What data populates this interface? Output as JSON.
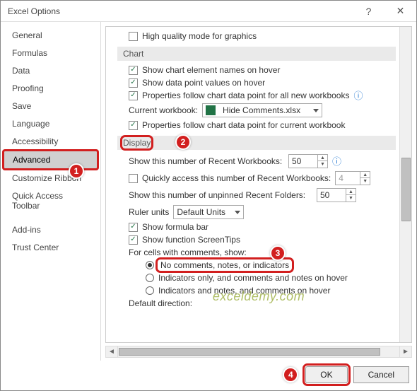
{
  "titlebar": {
    "title": "Excel Options",
    "help_icon": "?",
    "close_icon": "✕"
  },
  "sidebar": {
    "items": [
      {
        "label": "General"
      },
      {
        "label": "Formulas"
      },
      {
        "label": "Data"
      },
      {
        "label": "Proofing"
      },
      {
        "label": "Save"
      },
      {
        "label": "Language"
      },
      {
        "label": "Accessibility"
      },
      {
        "label": "Advanced"
      },
      {
        "label": "Customize Ribbon"
      },
      {
        "label": "Quick Access Toolbar"
      },
      {
        "label": "Add-ins"
      },
      {
        "label": "Trust Center"
      }
    ],
    "selected_index": 7
  },
  "main": {
    "top_checkbox": {
      "checked": false,
      "label": "High quality mode for graphics"
    },
    "chart_header": "Chart",
    "chart": {
      "show_element_names": {
        "checked": true,
        "label": "Show chart element names on hover"
      },
      "show_values": {
        "checked": true,
        "label": "Show data point values on hover"
      },
      "properties_all": {
        "checked": true,
        "label": "Properties follow chart data point for all new workbooks"
      },
      "current_workbook_label": "Current workbook:",
      "current_workbook_value": "Hide Comments.xlsx",
      "properties_current": {
        "checked": true,
        "label": "Properties follow chart data point for current workbook"
      }
    },
    "display_header": "Display",
    "display": {
      "recent_wb_label": "Show this number of Recent Workbooks:",
      "recent_wb_value": "50",
      "quick_access": {
        "checked": false,
        "label": "Quickly access this number of Recent Workbooks:",
        "value": "4"
      },
      "recent_folders_label": "Show this number of unpinned Recent Folders:",
      "recent_folders_value": "50",
      "ruler_label": "Ruler units",
      "ruler_value": "Default Units",
      "show_formula_bar": {
        "checked": true,
        "label": "Show formula bar"
      },
      "show_screentips": {
        "checked": true,
        "label": "Show function ScreenTips"
      },
      "comments_label": "For cells with comments, show:",
      "comments_options": [
        {
          "label": "No comments, notes, or indicators",
          "selected": true
        },
        {
          "label": "Indicators only, and comments and notes on hover",
          "selected": false
        },
        {
          "label": "Indicators and notes, and comments on hover",
          "selected": false
        }
      ],
      "default_direction_label": "Default direction:"
    }
  },
  "footer": {
    "ok": "OK",
    "cancel": "Cancel"
  },
  "watermark": "exceldemy.com",
  "badges": [
    "1",
    "2",
    "3",
    "4"
  ]
}
